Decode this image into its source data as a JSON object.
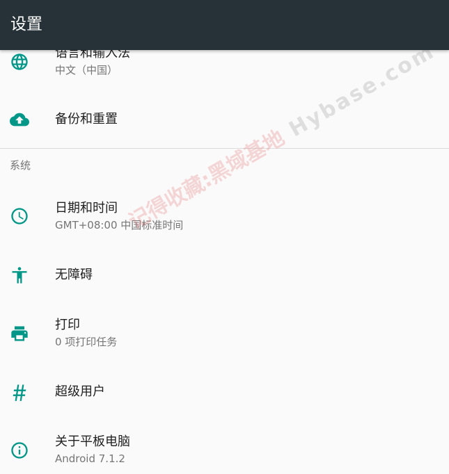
{
  "toolbar": {
    "title": "设置",
    "background_color": "#263238"
  },
  "accent_color": "#009688",
  "items_top": [
    {
      "title": "语言和输入法",
      "summary": "中文（中国）",
      "icon": "globe-icon"
    },
    {
      "title": "备份和重置",
      "icon": "cloud-upload-icon"
    }
  ],
  "category_system": "系统",
  "items_system": [
    {
      "title": "日期和时间",
      "summary": "GMT+08:00 中国标准时间",
      "icon": "clock-icon"
    },
    {
      "title": "无障碍",
      "icon": "accessibility-icon"
    },
    {
      "title": "打印",
      "summary": "0 项打印任务",
      "icon": "printer-icon"
    },
    {
      "title": "超级用户",
      "icon": "hash-icon"
    },
    {
      "title": "关于平板电脑",
      "summary": "Android 7.1.2",
      "icon": "info-icon"
    }
  ],
  "watermark": {
    "cn": "记得收藏:黑域基地",
    "en": "Hybase.com"
  }
}
